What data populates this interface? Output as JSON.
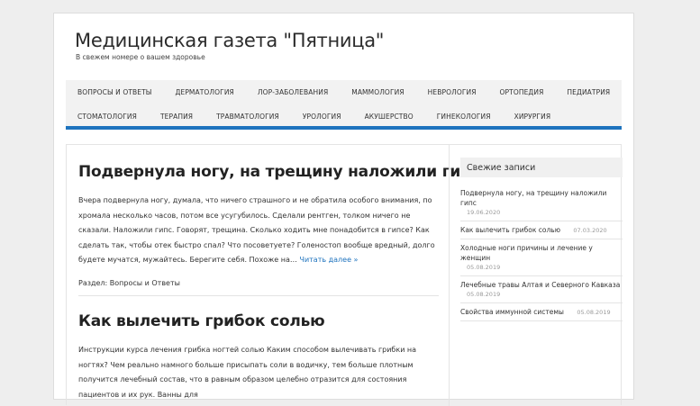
{
  "site": {
    "title": "Медицинская газета \"Пятница\"",
    "description": "В свежем номере о вашем здоровье"
  },
  "nav": {
    "row1": [
      "ВОПРОСЫ И ОТВЕТЫ",
      "ДЕРМАТОЛОГИЯ",
      "ЛОР-ЗАБОЛЕВАНИЯ",
      "МАММОЛОГИЯ",
      "НЕВРОЛОГИЯ",
      "ОРТОПЕДИЯ",
      "ПЕДИАТРИЯ"
    ],
    "row2": [
      "СТОМАТОЛОГИЯ",
      "ТЕРАПИЯ",
      "ТРАВМАТОЛОГИЯ",
      "УРОЛОГИЯ",
      "АКУШЕРСТВО",
      "ГИНЕКОЛОГИЯ",
      "ХИРУРГИЯ"
    ]
  },
  "posts": [
    {
      "title": "Подвернула ногу, на трещину наложили гипс",
      "excerpt": "Вчера подвернула ногу, думала, что ничего страшного и не обратила особого внимания, по хромала несколько часов, потом все усугубилось. Сделали рентген, толком ничего не сказали. Наложили гипс. Говорят, трещина. Сколько ходить мне понадобится в гипсе? Как сделать так, чтобы отек быстро спал? Что посоветуете? Голеностоп вообще вредный, долго будете мучатся, мужайтесь. Берегите себя. Похоже на…",
      "read_more": "Читать далее »",
      "meta_label": "Раздел:",
      "category": "Вопросы и Ответы"
    },
    {
      "title": "Как вылечить грибок солью",
      "excerpt": "Инструкции курса лечения грибка ногтей солью Каким способом вылечивать грибки на ногтях? Чем реально намного больше присыпать соли в водичку, тем больше плотным получится лечебный состав, что в равным образом целебно отразится для состояния пациентов и их рук. Ванны для"
    }
  ],
  "sidebar": {
    "widget_title": "Свежие записи",
    "items": [
      {
        "title": "Подвернула ногу, на трещину наложили гипс",
        "date": "19.06.2020"
      },
      {
        "title": "Как вылечить грибок солью",
        "date": "07.03.2020"
      },
      {
        "title": "Холодные ноги причины и лечение у женщин",
        "date": "05.08.2019"
      },
      {
        "title": "Лечебные травы Алтая и Северного Кавказа",
        "date": "05.08.2019"
      },
      {
        "title": "Свойства иммунной системы",
        "date": "05.08.2019"
      }
    ]
  },
  "colors": {
    "accent": "#1e73be",
    "nav_bg": "#f2f2f2",
    "page_bg": "#eeeeee"
  }
}
